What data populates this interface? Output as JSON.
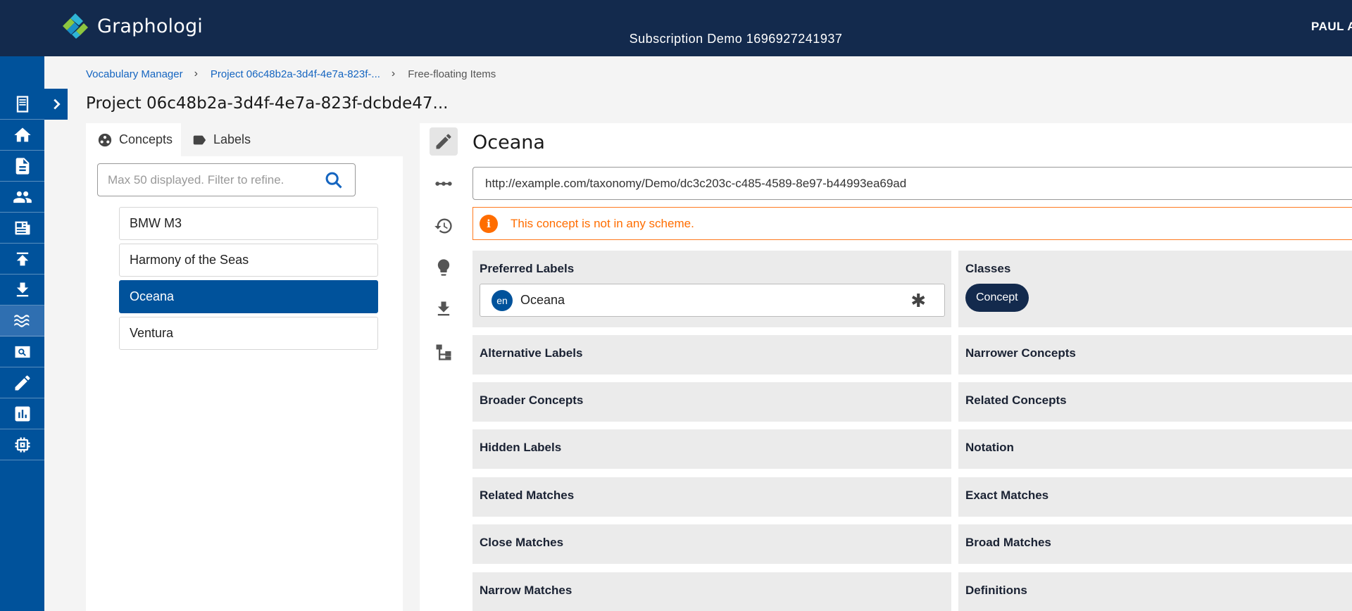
{
  "app": {
    "name": "Graphologi",
    "subscription": "Subscription Demo 1696927241937",
    "user": "PAUL A"
  },
  "sidebar": {
    "items": [
      {
        "icon": "book-icon"
      },
      {
        "icon": "home-icon"
      },
      {
        "icon": "document-icon"
      },
      {
        "icon": "users-icon"
      },
      {
        "icon": "newspaper-icon"
      },
      {
        "icon": "upload-icon"
      },
      {
        "icon": "download-icon"
      },
      {
        "icon": "waves-icon"
      },
      {
        "icon": "search-card-icon"
      },
      {
        "icon": "pencil-icon"
      },
      {
        "icon": "bar-chart-icon"
      },
      {
        "icon": "chip-icon"
      }
    ],
    "active_index": 7
  },
  "breadcrumb": {
    "items": [
      "Vocabulary Manager",
      "Project 06c48b2a-3d4f-4e7a-823f-..."
    ],
    "current": "Free-floating Items"
  },
  "page_title": "Project 06c48b2a-3d4f-4e7a-823f-dcbde47...",
  "left_panel": {
    "tabs": [
      {
        "label": "Concepts",
        "icon": "concepts-icon",
        "active": true
      },
      {
        "label": "Labels",
        "icon": "tag-icon",
        "active": false
      }
    ],
    "search": {
      "placeholder": "Max 50 displayed. Filter to refine.",
      "value": ""
    },
    "concepts": [
      "BMW M3",
      "Harmony of the Seas",
      "Oceana",
      "Ventura"
    ],
    "selected": "Oceana"
  },
  "concept": {
    "title": "Oceana",
    "uri": "http://example.com/taxonomy/Demo/dc3c203c-c485-4589-8e97-b44993ea69ad",
    "warning": "This concept is not in any scheme.",
    "preferred_labels": {
      "label": "Preferred Labels",
      "entries": [
        {
          "lang": "en",
          "value": "Oceana",
          "mark": "✱"
        }
      ]
    },
    "classes": {
      "label": "Classes",
      "chips": [
        "Concept"
      ]
    },
    "properties_left": [
      "Alternative Labels",
      "Broader Concepts",
      "Hidden Labels",
      "Related Matches",
      "Close Matches",
      "Narrow Matches"
    ],
    "properties_right": [
      "Narrower Concepts",
      "Related Concepts",
      "Notation",
      "Exact Matches",
      "Broad Matches",
      "Definitions"
    ]
  },
  "tools": [
    "pencil-icon",
    "link-icon",
    "history-icon",
    "lightbulb-icon",
    "download-icon",
    "hierarchy-icon"
  ],
  "colors": {
    "header": "#132a4d",
    "sidebar": "#00529b",
    "accent": "#1565c0",
    "warning": "#ff6d00"
  }
}
